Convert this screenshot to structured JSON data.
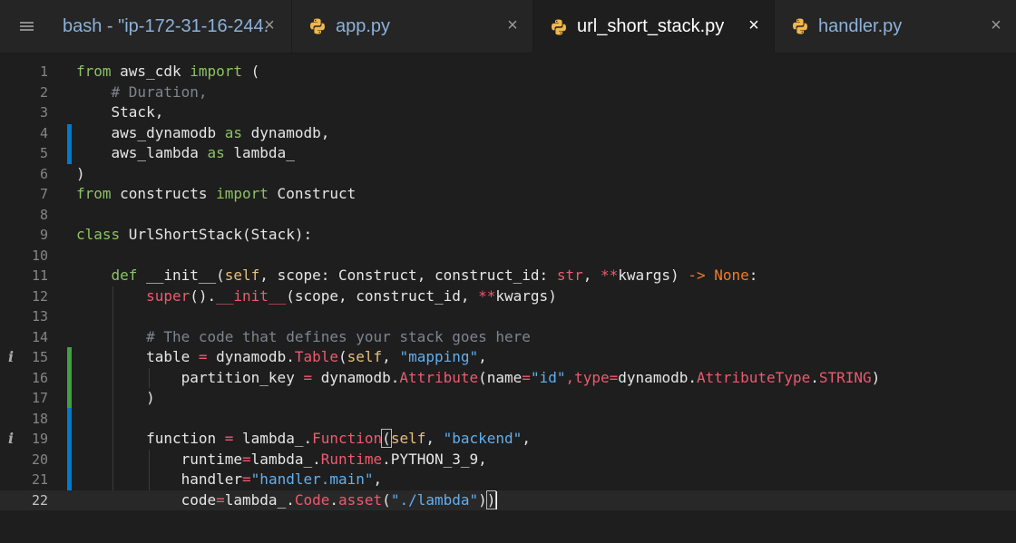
{
  "tabs": [
    {
      "label": "bash - \"ip-172-31-16-244.",
      "close": "×",
      "icon": "terminal",
      "active": false
    },
    {
      "label": "app.py",
      "close": "×",
      "icon": "python-icon",
      "active": false
    },
    {
      "label": "url_short_stack.py",
      "close": "×",
      "icon": "python-icon",
      "active": true
    },
    {
      "label": "handler.py",
      "close": "×",
      "icon": "python-icon",
      "active": false
    }
  ],
  "menu_icon": "hamburger-menu-icon",
  "editor": {
    "line_numbers": [
      "1",
      "2",
      "3",
      "4",
      "5",
      "6",
      "7",
      "8",
      "9",
      "10",
      "11",
      "12",
      "13",
      "14",
      "15",
      "16",
      "17",
      "18",
      "19",
      "20",
      "21",
      "22"
    ],
    "current_line": "22",
    "info_markers": [
      "15",
      "19"
    ],
    "lines": {
      "l1": {
        "a": "from",
        "b": " aws_cdk ",
        "c": "import",
        "d": " ("
      },
      "l2": {
        "a": "    ",
        "b": "# Duration,"
      },
      "l3": {
        "a": "    Stack,"
      },
      "l4": {
        "a": "    aws_dynamodb ",
        "b": "as",
        "c": " dynamodb,"
      },
      "l5": {
        "a": "    aws_lambda ",
        "b": "as",
        "c": " lambda_"
      },
      "l6": {
        "a": ")"
      },
      "l7": {
        "a": "from",
        "b": " constructs ",
        "c": "import",
        "d": " Construct"
      },
      "l9": {
        "a": "class",
        "b": " UrlShortStack(Stack):"
      },
      "l11": {
        "a": "    ",
        "b": "def",
        "c": " __init__(",
        "d": "self",
        "e": ", scope: Construct, construct_id: ",
        "f": "str",
        "g": ", ",
        "h": "**",
        "i": "kwargs) ",
        "j": "->",
        "k": " ",
        "l": "None",
        "m": ":"
      },
      "l12": {
        "a": "        ",
        "b": "super",
        "c": "().",
        "d": "__init__",
        "e": "(scope, construct_id, ",
        "f": "**",
        "g": "kwargs)"
      },
      "l14": {
        "a": "        ",
        "b": "# The code that defines your stack goes here"
      },
      "l15": {
        "a": "        table ",
        "b": "=",
        "c": " dynamodb.",
        "d": "Table",
        "e": "(",
        "f": "self",
        "g": ", ",
        "h": "\"mapping\"",
        "i": ","
      },
      "l16": {
        "a": "            partition_key ",
        "b": "=",
        "c": " dynamodb.",
        "d": "Attribute",
        "e": "(name",
        "f": "=",
        "g": "\"id\"",
        "h": ",type",
        "i": "=",
        "j": "dynamodb.",
        "k": "AttributeType",
        "l": ".",
        "m": "STRING",
        "n": ")"
      },
      "l17": {
        "a": "        )"
      },
      "l19": {
        "a": "        function ",
        "b": "=",
        "c": " lambda_.",
        "d": "Function",
        "e": "(",
        "f": "self",
        "g": ", ",
        "h": "\"backend\"",
        "i": ","
      },
      "l20": {
        "a": "            runtime",
        "b": "=",
        "c": "lambda_.",
        "d": "Runtime",
        "e": ".PYTHON_3_9,"
      },
      "l21": {
        "a": "            handler",
        "b": "=",
        "c": "\"handler.main\"",
        "d": ","
      },
      "l22": {
        "a": "            code",
        "b": "=",
        "c": "lambda_.",
        "d": "Code",
        "e": ".",
        "f": "asset",
        "g": "(",
        "h": "\"./lambda\"",
        "i": ")",
        "j": ")"
      }
    }
  },
  "colors": {
    "modified_marker": "#007acc",
    "added_marker": "#3fa13f",
    "tab_text": "#8cb2da"
  }
}
